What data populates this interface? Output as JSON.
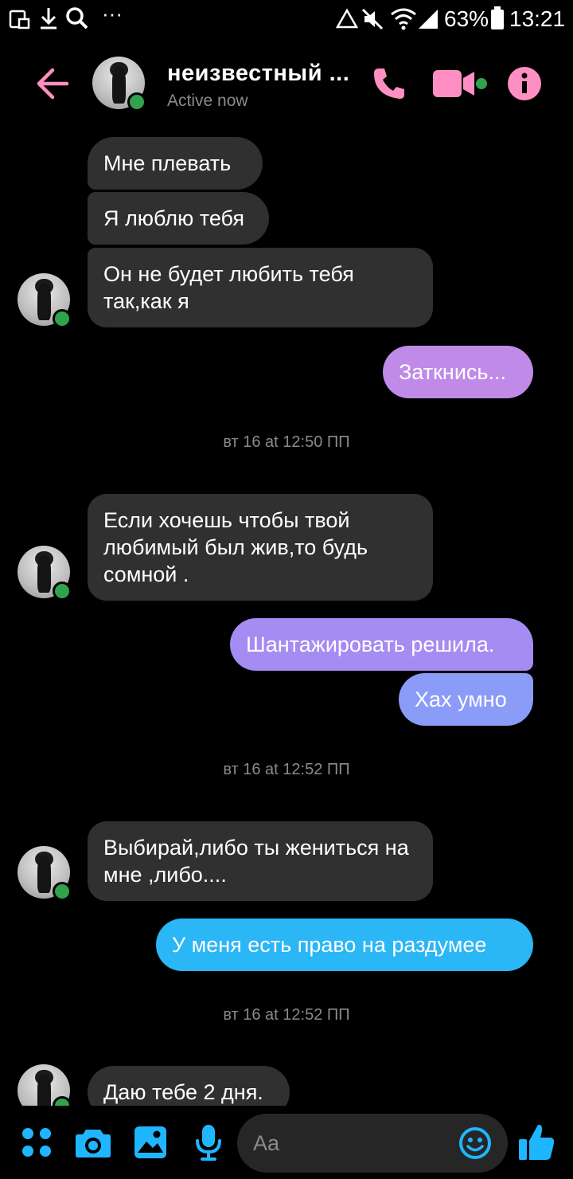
{
  "status_bar": {
    "battery": "63%",
    "time": "13:21",
    "overflow": "···"
  },
  "header": {
    "contact_name": "неизвестный ...",
    "presence": "Active now",
    "accent_color": "#ff8fc3"
  },
  "messages": [
    {
      "side": "in",
      "text": "Мне плевать"
    },
    {
      "side": "in",
      "text": "Я люблю тебя"
    },
    {
      "side": "in",
      "text": "Он не будет любить тебя так,как я"
    },
    {
      "side": "out",
      "text": "Заткнись..."
    },
    {
      "side": "in",
      "text": "Если хочешь чтобы твой любимый был жив,то будь сомной ."
    },
    {
      "side": "out",
      "text": "Шантажировать решила."
    },
    {
      "side": "out",
      "text": "Хах умно"
    },
    {
      "side": "in",
      "text": "Выбирай,либо ты жениться на мне ,либо...."
    },
    {
      "side": "out",
      "text": "У меня есть право на раздумее"
    },
    {
      "side": "in",
      "text": "Даю тебе 2 дня."
    }
  ],
  "timestamps": [
    "вт 16 at 12:50 ПП",
    "вт 16 at 12:52 ПП",
    "вт 16 at 12:52 ПП"
  ],
  "composer": {
    "placeholder": "Aa",
    "icon_color": "#1fb6ff"
  },
  "icons": [
    "back-arrow-icon",
    "phone-icon",
    "video-camera-icon",
    "info-icon",
    "menu-dots-icon",
    "camera-icon",
    "gallery-icon",
    "microphone-icon",
    "emoji-icon",
    "thumbs-up-icon"
  ]
}
